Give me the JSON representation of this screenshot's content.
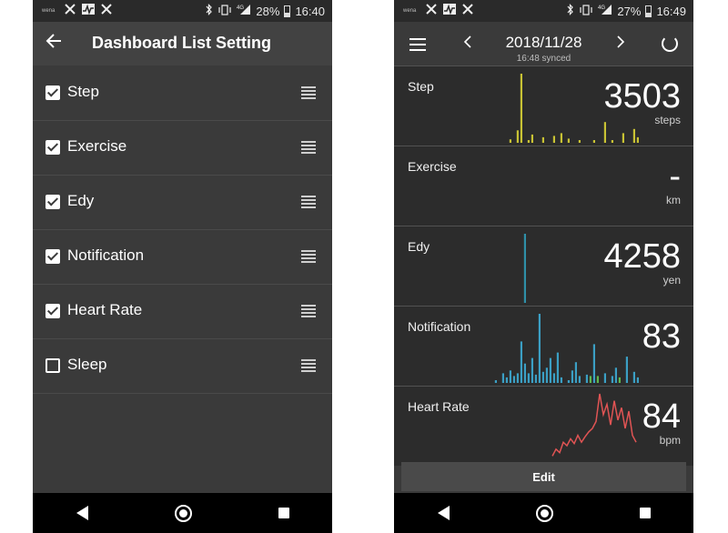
{
  "left_phone": {
    "statusbar": {
      "carrier": "wena",
      "battery": "28%",
      "time": "16:40",
      "signal": "4G"
    },
    "appbar": {
      "title": "Dashboard List Setting"
    },
    "items": [
      {
        "label": "Step",
        "checked": true
      },
      {
        "label": "Exercise",
        "checked": true
      },
      {
        "label": "Edy",
        "checked": true
      },
      {
        "label": "Notification",
        "checked": true
      },
      {
        "label": "Heart Rate",
        "checked": true
      },
      {
        "label": "Sleep",
        "checked": false
      }
    ]
  },
  "right_phone": {
    "statusbar": {
      "carrier": "wena",
      "battery": "27%",
      "time": "16:49",
      "signal": "4G"
    },
    "header": {
      "date": "2018/11/28",
      "synced": "16:48 synced"
    },
    "metrics": [
      {
        "name": "Step",
        "value": "3503",
        "unit": "steps",
        "color": "#c8c234",
        "bars": [
          0,
          0,
          0,
          0,
          5,
          0,
          18,
          100,
          0,
          4,
          12,
          0,
          0,
          8,
          0,
          0,
          10,
          0,
          14,
          0,
          6,
          0,
          0,
          4,
          0,
          0,
          0,
          4,
          0,
          0,
          30,
          0,
          4,
          0,
          0,
          14,
          0,
          0,
          20,
          8
        ]
      },
      {
        "name": "Exercise",
        "value": "-",
        "unit": "km",
        "color": "#c8c234",
        "bars": []
      },
      {
        "name": "Edy",
        "value": "4258",
        "unit": "yen",
        "color": "#2f8fa8",
        "bars": [
          0,
          0,
          0,
          0,
          0,
          0,
          0,
          0,
          100,
          0,
          0,
          0,
          0,
          0,
          0,
          0,
          0,
          0,
          0,
          0,
          0,
          0,
          0,
          0,
          0,
          0,
          0,
          0,
          0,
          0,
          0,
          0,
          0,
          0,
          0,
          0,
          0,
          0,
          0,
          0
        ]
      },
      {
        "name": "Notification",
        "value": "83",
        "unit": "",
        "color": "#3b9fc4",
        "accent": "#5fb84e",
        "bars": [
          4,
          0,
          14,
          8,
          18,
          10,
          14,
          60,
          28,
          14,
          36,
          12,
          100,
          16,
          22,
          36,
          14,
          44,
          8,
          0,
          4,
          18,
          30,
          10,
          0,
          12,
          10,
          56,
          10,
          0,
          14,
          0,
          10,
          22,
          8,
          0,
          38,
          0,
          16,
          8
        ],
        "accent_bars": [
          0,
          0,
          0,
          0,
          0,
          0,
          0,
          0,
          0,
          0,
          0,
          0,
          0,
          0,
          0,
          0,
          0,
          0,
          0,
          0,
          0,
          0,
          0,
          0,
          0,
          0,
          0,
          0,
          0,
          0,
          0,
          0,
          0,
          0,
          0,
          0,
          0,
          0,
          0,
          0
        ]
      },
      {
        "name": "Heart Rate",
        "value": "84",
        "unit": "bpm",
        "color": "#e05454",
        "line": [
          0,
          0,
          0,
          0,
          0,
          0,
          0,
          0,
          0,
          0,
          0,
          0,
          0,
          0,
          0,
          0,
          10,
          20,
          15,
          30,
          25,
          35,
          28,
          40,
          30,
          38,
          45,
          50,
          60,
          100,
          70,
          85,
          55,
          90,
          62,
          80,
          50,
          75,
          40,
          30
        ]
      }
    ],
    "edit_label": "Edit"
  }
}
